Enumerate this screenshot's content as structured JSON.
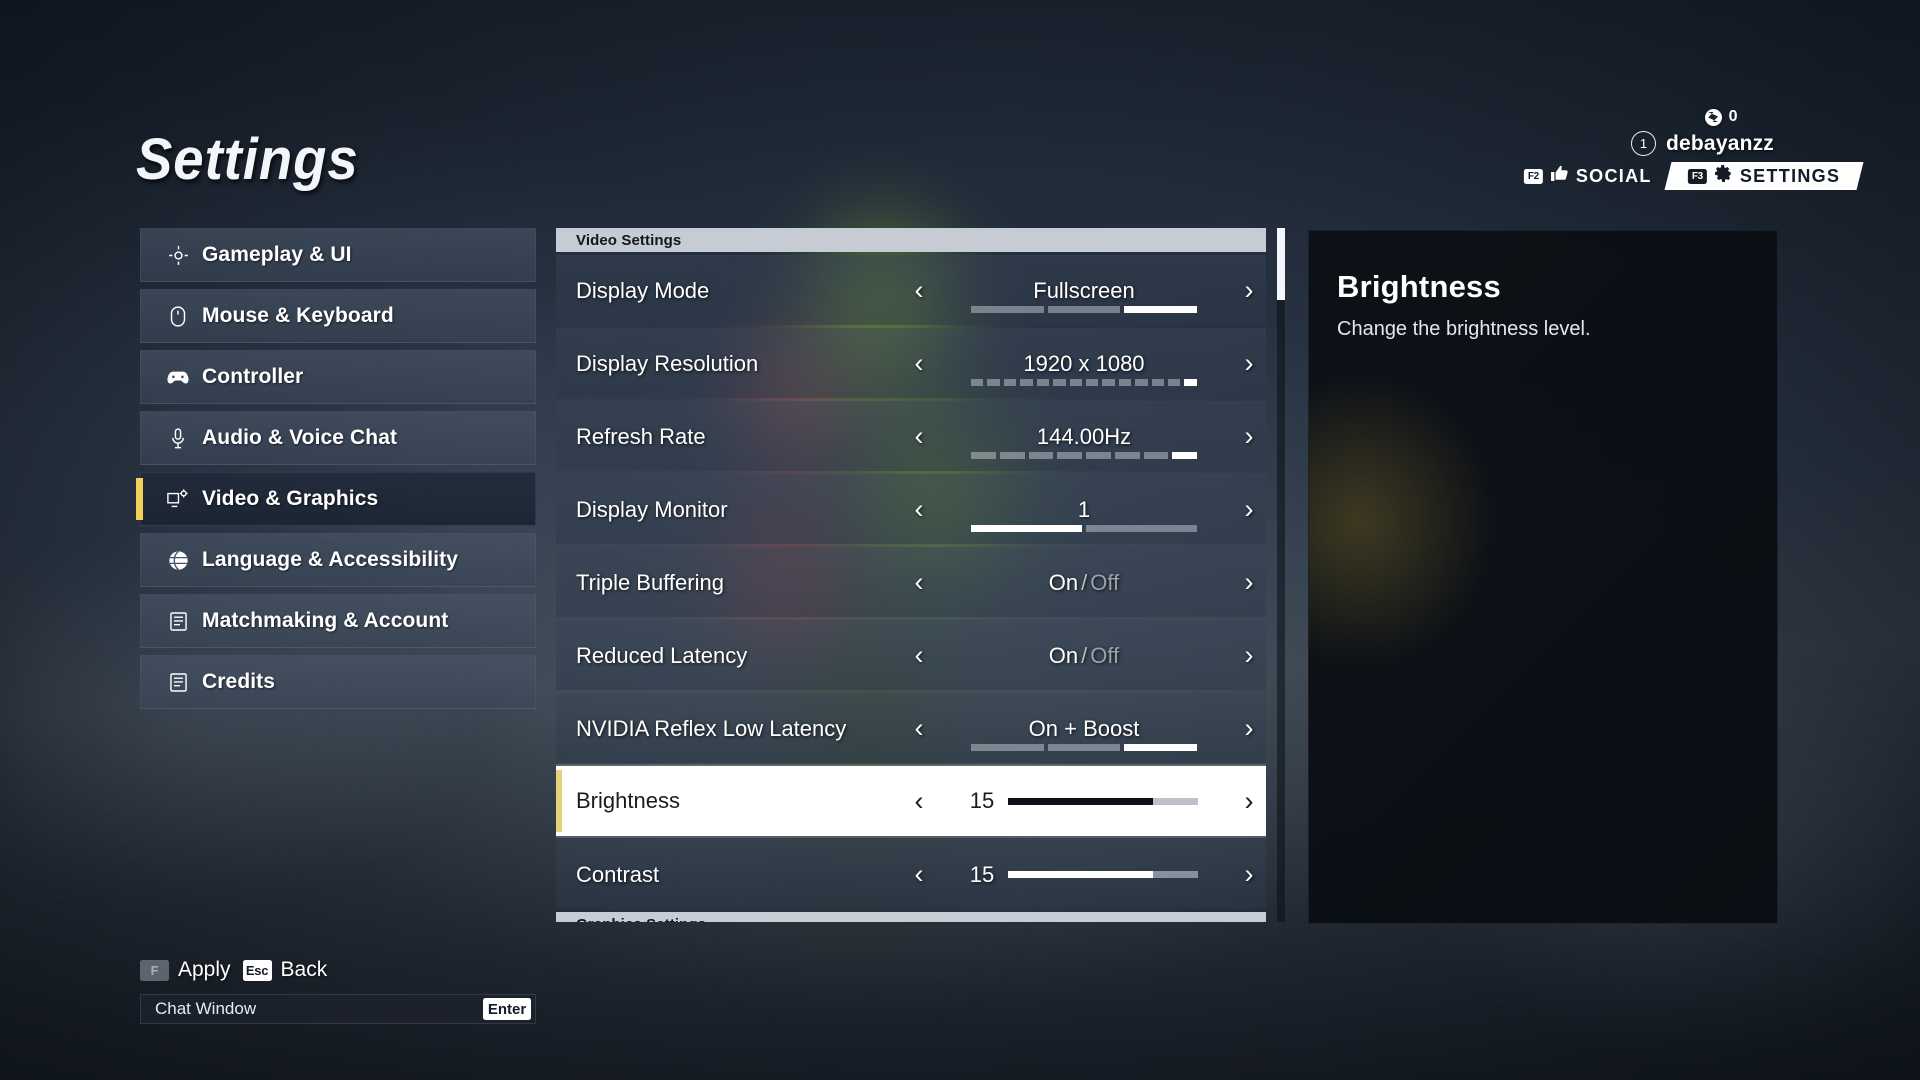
{
  "page_title": "Settings",
  "hud": {
    "currency_icon": "shard-icon",
    "currency_value": "0",
    "level": "1",
    "username": "debayanzz",
    "tabs": [
      {
        "key": "F2",
        "icon": "social-thumbs-icon",
        "label": "SOCIAL",
        "active": false
      },
      {
        "key": "F3",
        "icon": "gear-icon",
        "label": "SETTINGS",
        "active": true
      }
    ]
  },
  "sidebar": {
    "items": [
      {
        "label": "Gameplay & UI",
        "icon": "crosshair-icon",
        "selected": false
      },
      {
        "label": "Mouse & Keyboard",
        "icon": "mouse-icon",
        "selected": false
      },
      {
        "label": "Controller",
        "icon": "gamepad-icon",
        "selected": false
      },
      {
        "label": "Audio & Voice Chat",
        "icon": "microphone-icon",
        "selected": false
      },
      {
        "label": "Video & Graphics",
        "icon": "monitor-gear-icon",
        "selected": true
      },
      {
        "label": "Language & Accessibility",
        "icon": "globe-icon",
        "selected": false
      },
      {
        "label": "Matchmaking & Account",
        "icon": "list-icon",
        "selected": false
      },
      {
        "label": "Credits",
        "icon": "list-icon",
        "selected": false
      }
    ]
  },
  "settings": {
    "section_header": "Video Settings",
    "next_section_header": "Graphics Settings",
    "rows": [
      {
        "label": "Display Mode",
        "value": "Fullscreen",
        "type": "segments",
        "segments_total": 3,
        "segments_active": 3,
        "selected": false
      },
      {
        "label": "Display Resolution",
        "value": "1920 x 1080",
        "type": "segments",
        "segments_total": 14,
        "segments_active": 14,
        "selected": false
      },
      {
        "label": "Refresh Rate",
        "value": "144.00Hz",
        "type": "segments",
        "segments_total": 8,
        "segments_active": 8,
        "selected": false
      },
      {
        "label": "Display Monitor",
        "value": "1",
        "type": "segments",
        "segments_total": 2,
        "segments_active": 1,
        "selected": false
      },
      {
        "label": "Triple Buffering",
        "value": "On",
        "value_off": "Off",
        "type": "toggle",
        "selected": false
      },
      {
        "label": "Reduced Latency",
        "value": "On",
        "value_off": "Off",
        "type": "toggle",
        "selected": false
      },
      {
        "label": "NVIDIA Reflex Low Latency",
        "value": "On + Boost",
        "type": "segments",
        "segments_total": 3,
        "segments_active": 3,
        "selected": false
      },
      {
        "label": "Brightness",
        "value": "15",
        "type": "slider",
        "fill_percent": 76,
        "selected": true
      },
      {
        "label": "Contrast",
        "value": "15",
        "type": "slider",
        "fill_percent": 76,
        "selected": false
      }
    ],
    "left_arrow": "‹",
    "right_arrow": "›"
  },
  "info_panel": {
    "title": "Brightness",
    "description": "Change the brightness level."
  },
  "footer": {
    "apply_key": "F",
    "apply_label": "Apply",
    "back_key": "Esc",
    "back_label": "Back",
    "chat_label": "Chat Window",
    "chat_key": "Enter"
  },
  "colors": {
    "accent_gold": "#f3d159",
    "selected_row_bg": "#ffffff",
    "section_header_bg": "#c7ccd4"
  }
}
